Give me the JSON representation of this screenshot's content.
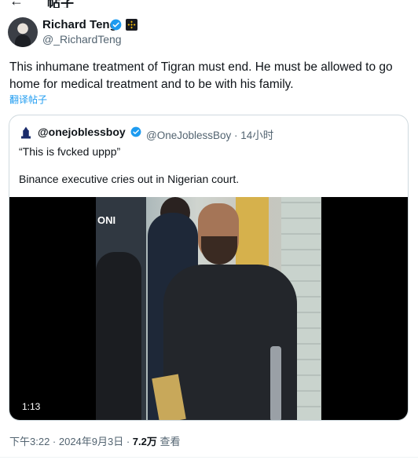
{
  "header": {
    "back_icon": "arrow-left-icon",
    "title": "帖子"
  },
  "author": {
    "name": "Richard Teng",
    "handle": "@_RichardTeng",
    "verified_color": "#1d9bf0",
    "badge_color": "#f0b90b"
  },
  "tweet": {
    "text": "This inhumane treatment of Tigran must end. He must be allowed to go home for medical treatment and to be with his family.",
    "translate_label": "翻译帖子"
  },
  "quote": {
    "name": "@onejoblessboy",
    "handle_time": "@OneJoblessBoy · 14小时",
    "text1": "“This is fvcked uppp”",
    "text2": "Binance executive cries out in Nigerian court.",
    "video": {
      "timestamp": "1:13",
      "frame_text": "ONI"
    }
  },
  "meta": {
    "time": "下午3:22 · 2024年9月3日 · ",
    "views": "7.2万",
    "views_label": " 查看"
  }
}
